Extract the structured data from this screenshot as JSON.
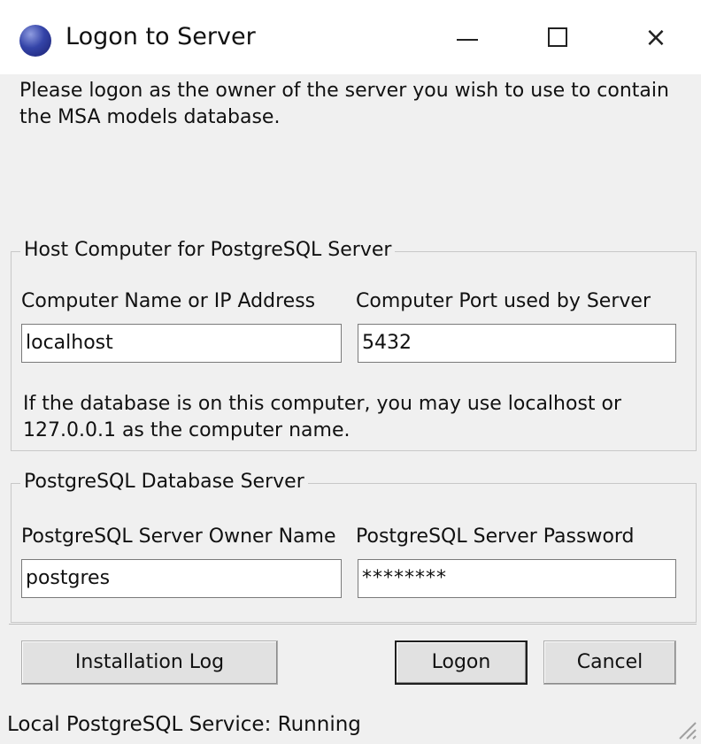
{
  "window": {
    "title": "Logon to Server",
    "icon": "postgres-globe-icon",
    "controls": {
      "minimize": "minimize-icon",
      "maximize": "maximize-icon",
      "close": "×"
    }
  },
  "intro_text": "Please logon as the owner of the server you wish to use to contain the MSA models database.",
  "host_group": {
    "legend": "Host Computer for PostgreSQL Server",
    "computer_name_label": "Computer Name or IP Address",
    "computer_name_value": "localhost",
    "port_label": "Computer Port used by Server",
    "port_value": "5432",
    "hint": "If the database is on this computer, you may use localhost or 127.0.0.1 as the computer name."
  },
  "db_group": {
    "legend": "PostgreSQL Database Server",
    "owner_label": "PostgreSQL Server Owner Name",
    "owner_value": "postgres",
    "password_label": "PostgreSQL Server Password",
    "password_value": "********"
  },
  "buttons": {
    "installation_log": "Installation Log",
    "logon": "Logon",
    "cancel": "Cancel"
  },
  "status_text": "Local PostgreSQL Service: Running"
}
